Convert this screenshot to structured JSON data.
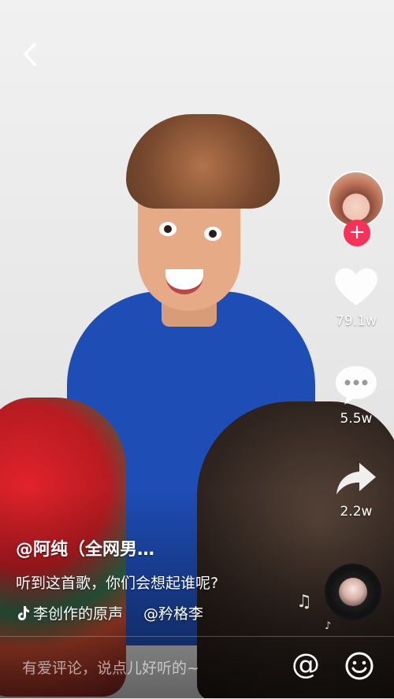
{
  "nav": {
    "back_icon": "chevron-left-icon"
  },
  "creator": {
    "follow_icon": "plus-icon",
    "follow_color": "#f6325b"
  },
  "actions": {
    "like": {
      "icon": "heart-icon",
      "count": "79.1w"
    },
    "comment": {
      "icon": "comment-bubble-icon",
      "count": "5.5w"
    },
    "share": {
      "icon": "share-arrow-icon",
      "count": "2.2w"
    }
  },
  "post": {
    "author": "@阿纯（全网男…",
    "caption": "听到这首歌，你们会想起谁呢?",
    "music_icon": "tiktok-note-icon",
    "music_label": "李创作的原声",
    "music_credit": "@矜格李"
  },
  "comment_bar": {
    "placeholder": "有爱评论，说点儿好听的~",
    "at_label": "@",
    "emoji_icon": "smiley-icon"
  }
}
